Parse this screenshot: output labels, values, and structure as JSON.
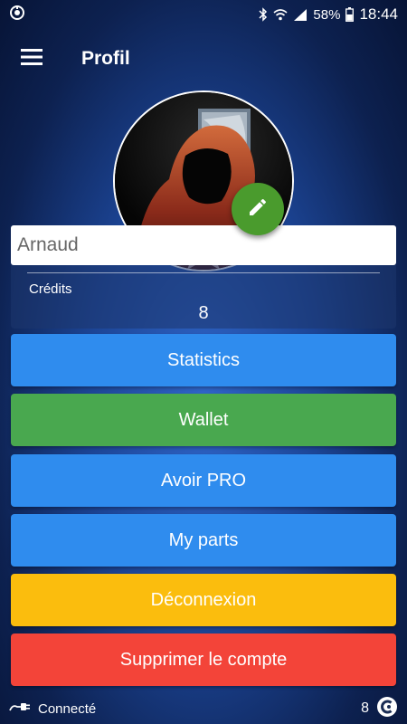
{
  "status_bar": {
    "battery": "58%",
    "time": "18:44",
    "icons": [
      "app-status-icon",
      "bluetooth-icon",
      "wifi-icon",
      "signal-icon",
      "battery-icon"
    ]
  },
  "app_bar": {
    "title": "Profil",
    "menu_icon": "hamburger-menu-icon"
  },
  "profile": {
    "avatar_description": "hooded-figure-avatar",
    "edit_icon": "pencil-icon",
    "edit_color": "#4a9b2d",
    "name_value": "Arnaud",
    "credits_label": "Crédits",
    "credits_value": "8"
  },
  "buttons": [
    {
      "label": "Statistics",
      "color": "#2f8cee"
    },
    {
      "label": "Wallet",
      "color": "#49a84f"
    },
    {
      "label": "Avoir PRO",
      "color": "#2f8cee"
    },
    {
      "label": "My parts",
      "color": "#2f8cee"
    },
    {
      "label": "Déconnexion",
      "color": "#fbbd0d"
    },
    {
      "label": "Supprimer le compte",
      "color": "#f34439"
    }
  ],
  "bottom_bar": {
    "connection_icon": "connection-plug-icon",
    "connection_status": "Connecté",
    "credits_count": "8",
    "credits_icon": "credits-coin-icon"
  }
}
